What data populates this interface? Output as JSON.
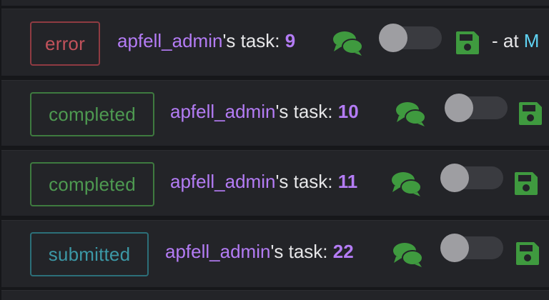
{
  "tasks": [
    {
      "status": "error",
      "user": "apfell_admin",
      "suffix": "'s task: ",
      "number": "9",
      "trail_text": "- at ",
      "trail_link": "M"
    },
    {
      "status": "completed",
      "user": "apfell_admin",
      "suffix": "'s task: ",
      "number": "10"
    },
    {
      "status": "completed",
      "user": "apfell_admin",
      "suffix": "'s task: ",
      "number": "11"
    },
    {
      "status": "submitted",
      "user": "apfell_admin",
      "suffix": "'s task: ",
      "number": "22"
    }
  ],
  "icons": {
    "comment": "comments-icon",
    "save": "save-icon"
  },
  "colors": {
    "error": "#c2525b",
    "completed": "#4e9a51",
    "submitted": "#3c98a6",
    "username": "#b47cf5",
    "icon_green": "#3f9a3f",
    "link": "#5fd3f3"
  }
}
